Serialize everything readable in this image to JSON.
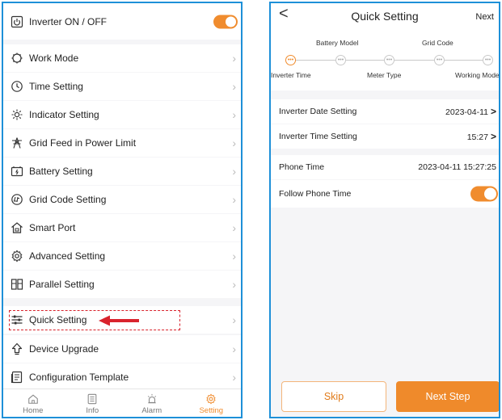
{
  "left": {
    "inverter_toggle_label": "Inverter ON / OFF",
    "menu": [
      {
        "label": "Work Mode",
        "icon": "work-mode-icon"
      },
      {
        "label": "Time Setting",
        "icon": "clock-icon"
      },
      {
        "label": "Indicator Setting",
        "icon": "indicator-icon"
      },
      {
        "label": "Grid Feed in Power Limit",
        "icon": "grid-tower-icon"
      },
      {
        "label": "Battery Setting",
        "icon": "battery-icon"
      },
      {
        "label": "Grid Code Setting",
        "icon": "grid-code-icon"
      },
      {
        "label": "Smart Port",
        "icon": "house-port-icon"
      },
      {
        "label": "Advanced Setting",
        "icon": "gear-icon"
      },
      {
        "label": "Parallel Setting",
        "icon": "parallel-icon"
      },
      {
        "label": "Quick Setting",
        "icon": "sliders-icon"
      },
      {
        "label": "Device Upgrade",
        "icon": "upgrade-arrow-icon"
      },
      {
        "label": "Configuration Template",
        "icon": "template-icon"
      }
    ],
    "tabs": [
      {
        "label": "Home",
        "icon": "home-icon"
      },
      {
        "label": "Info",
        "icon": "info-doc-icon"
      },
      {
        "label": "Alarm",
        "icon": "alarm-icon"
      },
      {
        "label": "Setting",
        "icon": "gear-icon",
        "active": true
      }
    ]
  },
  "right": {
    "back_glyph": "<",
    "title": "Quick Setting",
    "next_label": "Next",
    "steps_top": [
      "Battery Model",
      "Grid Code"
    ],
    "steps_bottom": [
      "Inverter Time",
      "Meter Type",
      "Working Mode"
    ],
    "inverter_date_label": "Inverter Date Setting",
    "inverter_date_value": "2023-04-11",
    "inverter_time_label": "Inverter Time Setting",
    "inverter_time_value": "15:27",
    "phone_time_label": "Phone Time",
    "phone_time_value": "2023-04-11 15:27:25",
    "follow_phone_time_label": "Follow Phone Time",
    "skip_label": "Skip",
    "next_step_label": "Next Step"
  },
  "colors": {
    "accent": "#f08c2e",
    "frame": "#1e90d8",
    "highlight": "#d9232d"
  }
}
